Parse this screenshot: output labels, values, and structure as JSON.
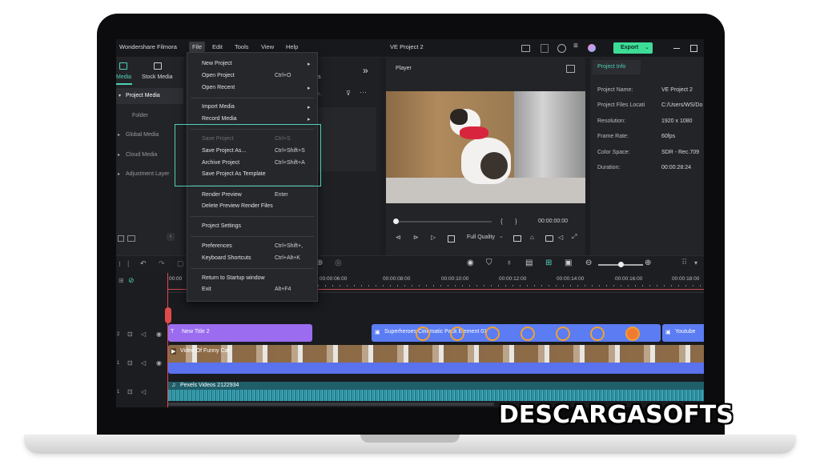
{
  "app": {
    "title": "Wondershare Filmora",
    "project_title": "VE Project 2",
    "export_label": "Export",
    "menu": [
      "File",
      "Edit",
      "Tools",
      "View",
      "Help"
    ]
  },
  "left_tabs": {
    "media": "Media",
    "stock_media": "Stock Media"
  },
  "left_panel": {
    "items": [
      "Project Media",
      "Folder",
      "Global Media",
      "Cloud Media",
      "Adjustment Layer"
    ]
  },
  "media_area": {
    "tab_partial": "ters",
    "search_partial": "m.."
  },
  "player": {
    "label": "Player",
    "time": "00:00:00:00",
    "quality": "Full Quality"
  },
  "project_info": {
    "tab": "Project Info",
    "rows": [
      {
        "label": "Project Name:",
        "value": "VE Project 2"
      },
      {
        "label": "Project Files Locati",
        "value": "C:/Users/WS/Do"
      },
      {
        "label": "Resolution:",
        "value": "1920 x 1080"
      },
      {
        "label": "Frame Rate:",
        "value": "60fps"
      },
      {
        "label": "Color Space:",
        "value": "SDR - Rec.709"
      },
      {
        "label": "Duration:",
        "value": "00:00:28:24"
      }
    ]
  },
  "file_menu": {
    "items": [
      {
        "label": "New Project",
        "shortcut": "",
        "submenu": true,
        "disabled": false
      },
      {
        "label": "Open Project",
        "shortcut": "Ctrl+O",
        "submenu": false,
        "disabled": false
      },
      {
        "label": "Open Recent",
        "shortcut": "",
        "submenu": true,
        "disabled": false
      },
      {
        "label": "Import Media",
        "shortcut": "",
        "submenu": true,
        "disabled": false
      },
      {
        "label": "Record Media",
        "shortcut": "",
        "submenu": true,
        "disabled": false
      },
      {
        "label": "Save Project",
        "shortcut": "Ctrl+S",
        "submenu": false,
        "disabled": true
      },
      {
        "label": "Save Project As...",
        "shortcut": "Ctrl+Shift+S",
        "submenu": false,
        "disabled": false
      },
      {
        "label": "Archive Project",
        "shortcut": "Ctrl+Shift+A",
        "submenu": false,
        "disabled": false
      },
      {
        "label": "Save Project As Template",
        "shortcut": "",
        "submenu": false,
        "disabled": false
      },
      {
        "label": "Render Preview",
        "shortcut": "Enter",
        "submenu": false,
        "disabled": false
      },
      {
        "label": "Delete Preview Render Files",
        "shortcut": "",
        "submenu": false,
        "disabled": false
      },
      {
        "label": "Project Settings",
        "shortcut": "",
        "submenu": false,
        "disabled": false
      },
      {
        "label": "Preferences",
        "shortcut": "Ctrl+Shift+,",
        "submenu": false,
        "disabled": false
      },
      {
        "label": "Keyboard Shortcuts",
        "shortcut": "Ctrl+Alt+K",
        "submenu": false,
        "disabled": false
      },
      {
        "label": "Return to Startup window",
        "shortcut": "",
        "submenu": false,
        "disabled": false
      },
      {
        "label": "Exit",
        "shortcut": "Alt+F4",
        "submenu": false,
        "disabled": false
      }
    ]
  },
  "timeline": {
    "ticks": [
      "00:00",
      "00:00:06:00",
      "00:00:08:00",
      "00:00:10:00",
      "00:00:12:00",
      "00:00:14:00",
      "00:00:16:00",
      "00:00:18:00"
    ],
    "track_numbers": [
      "2",
      "1",
      "1"
    ],
    "clips": {
      "title": "New Title 2",
      "element": "Superheroes Cinematic Pack Element 01",
      "youtube": "Youtube",
      "video": "Video Of Funny Cat",
      "audio": "Pexels Videos 2122934"
    }
  },
  "watermark": "DESCARGASOFTS",
  "colors": {
    "accent": "#4fd0b6",
    "export": "#3ddc97",
    "title_clip": "#9b6cf0",
    "element_clip": "#5b7cf2",
    "video_track": "#5a72ee",
    "audio_track": "#2c8c9c",
    "playhead": "#e04a4a"
  }
}
